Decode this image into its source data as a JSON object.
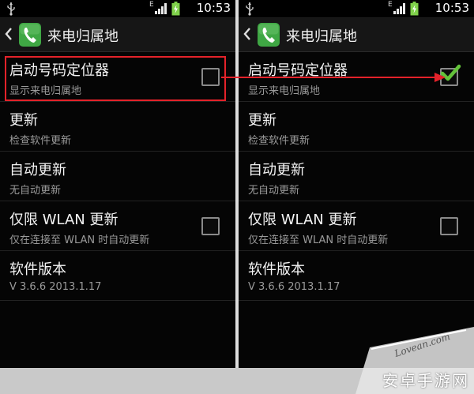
{
  "screens": [
    {
      "status": {
        "network": "E",
        "time": "10:53"
      },
      "title": "来电归属地",
      "settings": [
        {
          "title": "启动号码定位器",
          "subtitle": "显示来电归属地",
          "checkbox": true,
          "checked": false
        },
        {
          "title": "更新",
          "subtitle": "检查软件更新",
          "checkbox": false
        },
        {
          "title": "自动更新",
          "subtitle": "无自动更新",
          "checkbox": false
        },
        {
          "title": "仅限 WLAN 更新",
          "subtitle": "仅在连接至 WLAN 时自动更新",
          "checkbox": true,
          "checked": false
        },
        {
          "title": "软件版本",
          "subtitle": "V 3.6.6 2013.1.17",
          "checkbox": false
        }
      ]
    },
    {
      "status": {
        "network": "E",
        "time": "10:53"
      },
      "title": "来电归属地",
      "settings": [
        {
          "title": "启动号码定位器",
          "subtitle": "显示来电归属地",
          "checkbox": true,
          "checked": true
        },
        {
          "title": "更新",
          "subtitle": "检查软件更新",
          "checkbox": false
        },
        {
          "title": "自动更新",
          "subtitle": "无自动更新",
          "checkbox": false
        },
        {
          "title": "仅限 WLAN 更新",
          "subtitle": "仅在连接至 WLAN 时自动更新",
          "checkbox": true,
          "checked": false
        },
        {
          "title": "软件版本",
          "subtitle": "V 3.6.6 2013.1.17",
          "checkbox": false
        }
      ]
    }
  ],
  "icons": {
    "usb": "usb-icon",
    "signal": "signal-bars-icon",
    "battery": "battery-charging-icon",
    "back": "back-chevron-icon",
    "app": "phone-app-icon",
    "check": "checkmark-icon"
  },
  "colors": {
    "highlight": "#e4222a",
    "check": "#63c23a",
    "app_icon": "#3fa744",
    "battery": "#7fd14a"
  },
  "watermark": {
    "latin": "Lovean.com",
    "chinese": "安卓手游网"
  }
}
